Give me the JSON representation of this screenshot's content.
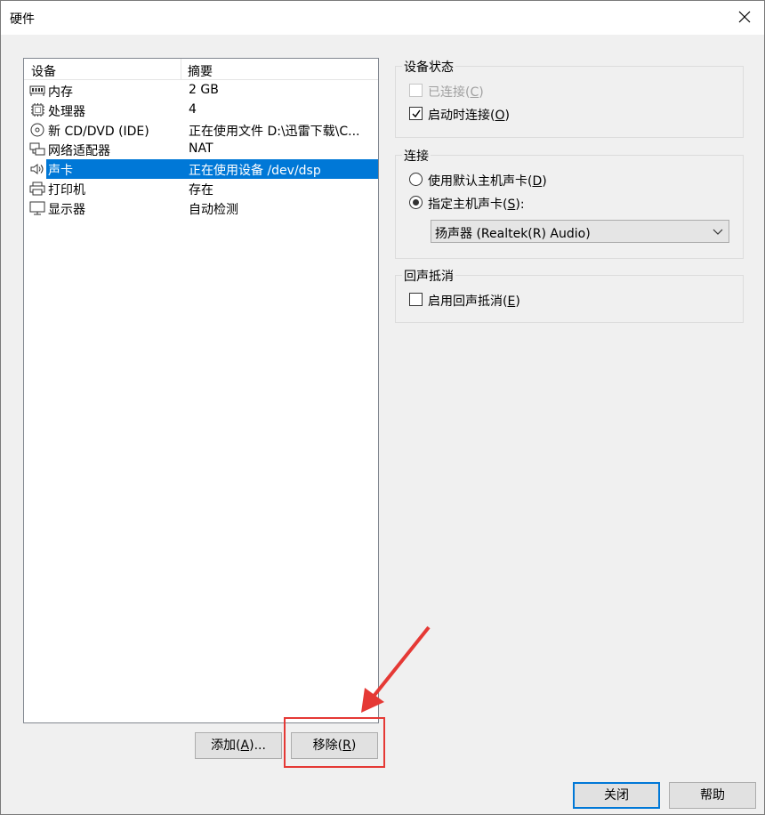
{
  "window": {
    "title": "硬件"
  },
  "list": {
    "headers": {
      "device": "设备",
      "summary": "摘要"
    },
    "rows": [
      {
        "device": "内存",
        "summary": "2 GB",
        "icon": "memory-icon"
      },
      {
        "device": "处理器",
        "summary": "4",
        "icon": "cpu-icon"
      },
      {
        "device": "新 CD/DVD (IDE)",
        "summary": "正在使用文件 D:\\迅雷下载\\C...",
        "icon": "cd-icon"
      },
      {
        "device": "网络适配器",
        "summary": "NAT",
        "icon": "network-icon"
      },
      {
        "device": "声卡",
        "summary": "正在使用设备 /dev/dsp",
        "icon": "speaker-icon",
        "selected": true
      },
      {
        "device": "打印机",
        "summary": "存在",
        "icon": "printer-icon"
      },
      {
        "device": "显示器",
        "summary": "自动检测",
        "icon": "monitor-icon"
      }
    ]
  },
  "buttons": {
    "add": {
      "text": "添加(",
      "key": "A",
      "tail": ")..."
    },
    "remove": {
      "text": "移除(",
      "key": "R",
      "tail": ")"
    },
    "close": "关闭",
    "help": "帮助"
  },
  "device_status": {
    "title": "设备状态",
    "connected": {
      "text": "已连接(",
      "key": "C",
      "tail": ")",
      "checked": false,
      "disabled": true
    },
    "connect_on_start": {
      "text": "启动时连接(",
      "key": "O",
      "tail": ")",
      "checked": true
    }
  },
  "connection": {
    "title": "连接",
    "default_card": {
      "text": "使用默认主机声卡(",
      "key": "D",
      "tail": ")",
      "selected": false
    },
    "specific_card": {
      "text": "指定主机声卡(",
      "key": "S",
      "tail": "):",
      "selected": true
    },
    "select_value": "扬声器 (Realtek(R) Audio)"
  },
  "echo": {
    "title": "回声抵消",
    "enable": {
      "text": "启用回声抵消(",
      "key": "E",
      "tail": ")",
      "checked": false
    }
  },
  "colors": {
    "selection": "#0078d7",
    "highlight": "#e53935"
  }
}
